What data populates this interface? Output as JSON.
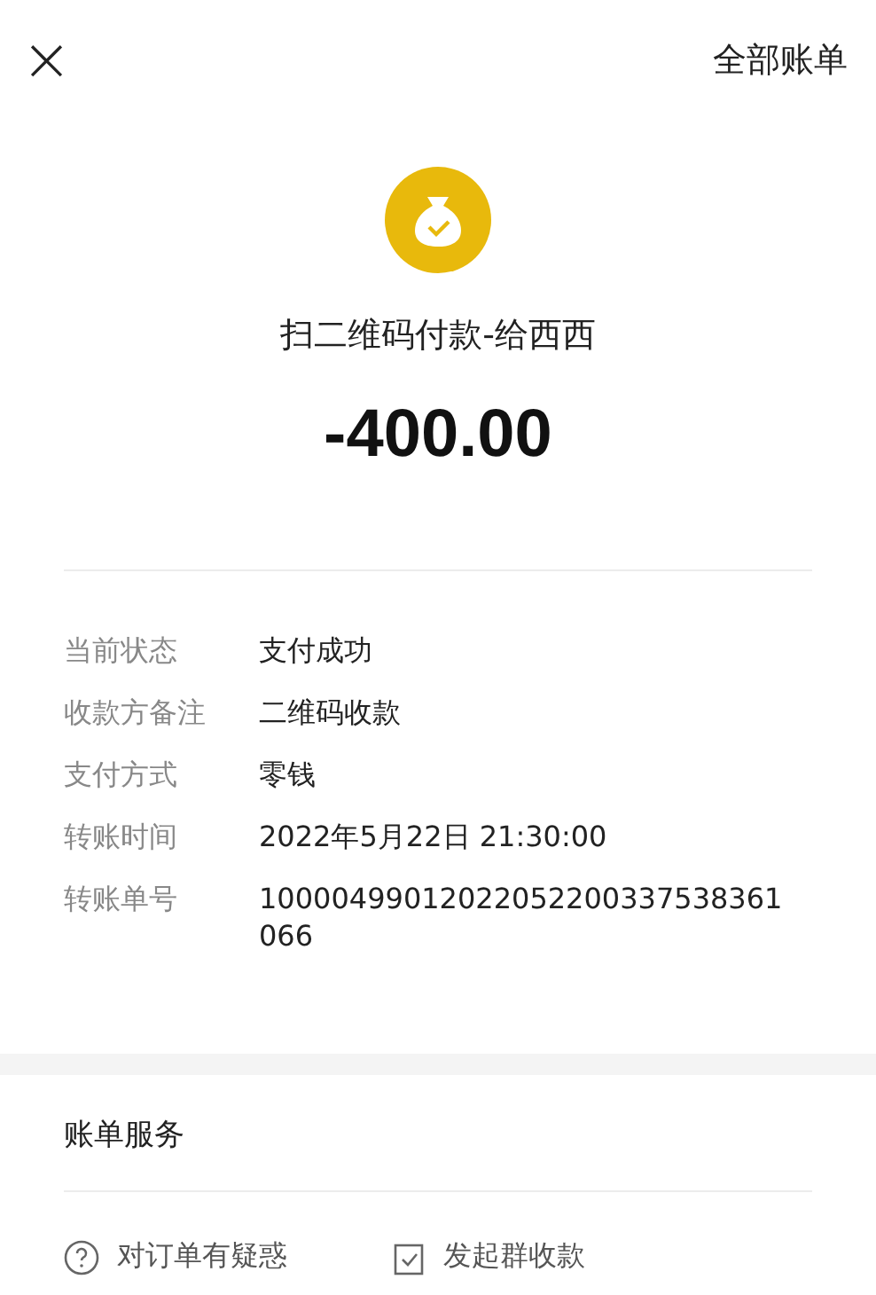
{
  "header": {
    "close": "×",
    "all_bills": "全部账单"
  },
  "payment": {
    "title": "扫二维码付款-给西西",
    "amount": "-400.00"
  },
  "details": [
    {
      "label": "当前状态",
      "value": "支付成功"
    },
    {
      "label": "收款方备注",
      "value": "二维码收款"
    },
    {
      "label": "支付方式",
      "value": "零钱"
    },
    {
      "label": "转账时间",
      "value": "2022年5月22日 21:30:00"
    },
    {
      "label": "转账单号",
      "value": "10000499012022052200337538361066"
    }
  ],
  "services": {
    "title": "账单服务",
    "actions": [
      {
        "kind": "question",
        "label": "对订单有疑惑"
      },
      {
        "kind": "group",
        "label": "发起群收款"
      }
    ]
  }
}
